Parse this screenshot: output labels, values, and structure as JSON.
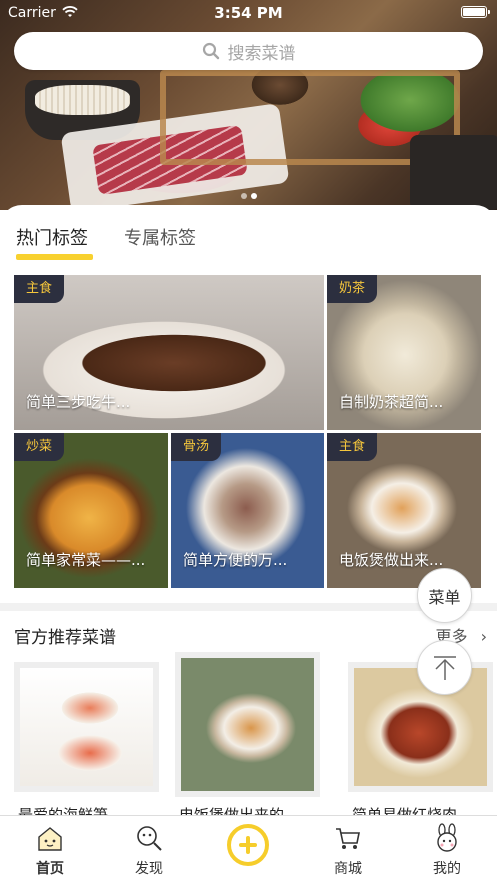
{
  "status_bar": {
    "carrier": "Carrier",
    "time": "3:54 PM"
  },
  "search": {
    "placeholder": "搜索菜谱"
  },
  "tabs": [
    {
      "label": "热门标签",
      "active": true
    },
    {
      "label": "专属标签",
      "active": false
    }
  ],
  "hot_recipes": [
    {
      "tag": "主食",
      "title": "简单三步吃牛..."
    },
    {
      "tag": "奶茶",
      "title": "自制奶茶超简..."
    },
    {
      "tag": "炒菜",
      "title": "简单家常菜——..."
    },
    {
      "tag": "骨汤",
      "title": "简单方便的万..."
    },
    {
      "tag": "主食",
      "title": "电饭煲做出来..."
    }
  ],
  "floating": {
    "menu_label": "菜单"
  },
  "recommended": {
    "title": "官方推荐菜谱",
    "more": "更多",
    "items": [
      {
        "title": "最爱的海鲜笋..."
      },
      {
        "title": "电饭煲做出来的..."
      },
      {
        "title": "简单易做红烧肉..."
      }
    ]
  },
  "tabbar": {
    "items": [
      {
        "label": "首页",
        "icon": "home-icon"
      },
      {
        "label": "发现",
        "icon": "discover-icon"
      },
      {
        "label": "",
        "icon": "add-icon"
      },
      {
        "label": "商城",
        "icon": "cart-icon"
      },
      {
        "label": "我的",
        "icon": "profile-icon"
      }
    ],
    "accent": "#f6cd2b"
  },
  "colors": {
    "accent": "#f8d12f",
    "tag_bg": "#2c2f3f",
    "tag_text": "#f5c63c"
  }
}
